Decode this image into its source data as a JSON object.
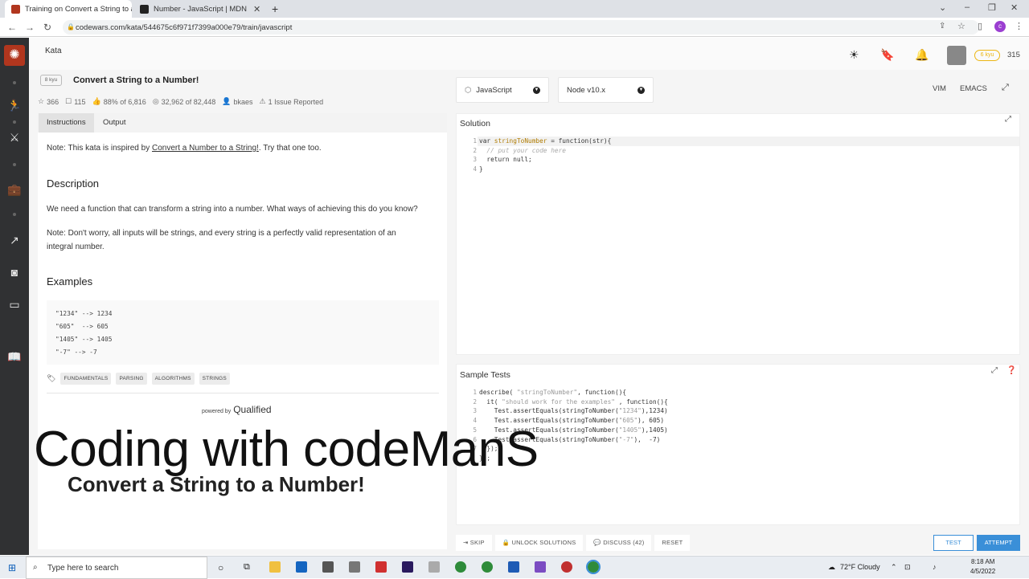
{
  "browser": {
    "tabs": [
      {
        "title": "Training on Convert a String to a",
        "active": true
      },
      {
        "title": "Number - JavaScript | MDN",
        "active": false
      }
    ],
    "url": "codewars.com/kata/544675c6f971f7399a000e79/train/javascript"
  },
  "topnav": {
    "section": "Kata",
    "rank": "6 kyu",
    "honor": "315"
  },
  "kata": {
    "kyu": "8 kyu",
    "title": "Convert a String to a Number!",
    "stats": {
      "stars": "366",
      "votes": "115",
      "satisfaction": "88% of 6,816",
      "completed": "32,962 of 82,448",
      "author": "bkaes",
      "issues": "1 Issue Reported"
    },
    "tabs": [
      "Instructions",
      "Output"
    ],
    "note_prefix": "Note: This kata is inspired by ",
    "note_link": "Convert a Number to a String!",
    "note_suffix": ". Try that one too.",
    "description_heading": "Description",
    "description": "We need a function that can transform a string into a number. What ways of achieving this do you know?",
    "note2": "Note: Don't worry, all inputs will be strings, and every string is a perfectly valid representation of an integral number.",
    "examples_heading": "Examples",
    "examples": "\"1234\" --> 1234\n\"605\"  --> 605\n\"1405\" --> 1405\n\"-7\" --> -7",
    "tags": [
      "FUNDAMENTALS",
      "PARSING",
      "ALGORITHMS",
      "STRINGS"
    ],
    "powered_by": "powered by",
    "powered_brand": "Qualified"
  },
  "overlay": {
    "line1": "Coding with codeManS",
    "line2": "Convert a String to a Number!"
  },
  "editor": {
    "language": "JavaScript",
    "runtime": "Node v10.x",
    "modes": [
      "VIM",
      "EMACS"
    ],
    "solution_title": "Solution",
    "solution_lines": [
      "1",
      "2",
      "3",
      "4"
    ],
    "tests_title": "Sample Tests",
    "tests_lines": [
      "1",
      "2",
      "3",
      "4",
      "5",
      "6",
      "7"
    ]
  },
  "actions": {
    "skip": "SKIP",
    "unlock": "UNLOCK SOLUTIONS",
    "discuss": "DISCUSS (42)",
    "reset": "RESET",
    "test": "TEST",
    "attempt": "ATTEMPT"
  },
  "taskbar": {
    "search_placeholder": "Type here to search",
    "weather": "72°F  Cloudy",
    "time": "8:18 AM",
    "date": "4/5/2022"
  },
  "colors": {
    "brand": "#b1361e",
    "accent": "#3a8fd8",
    "rank": "#ecb613",
    "sidebar": "#303133"
  }
}
